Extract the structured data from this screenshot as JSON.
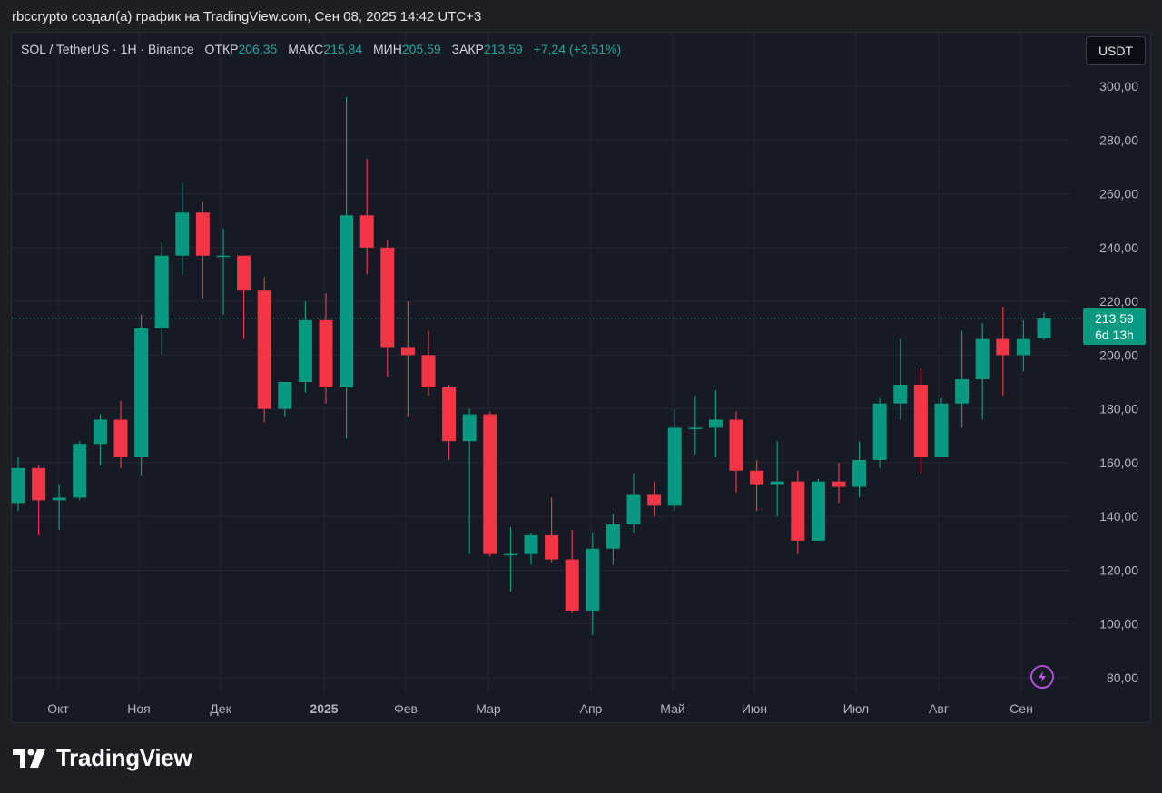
{
  "caption": "rbccrypto создал(а) график на TradingView.com, Сен 08, 2025 14:42 UTC+3",
  "legend": {
    "symbol": "SOL / TetherUS · 1H · Binance",
    "open_label": "ОТКР",
    "open_value": "206,35",
    "high_label": "МАКС",
    "high_value": "215,84",
    "low_label": "МИН",
    "low_value": "205,59",
    "close_label": "ЗАКР",
    "close_value": "213,59",
    "change": "+7,24 (+3,51%)"
  },
  "unit_button": "USDT",
  "last_price": {
    "value": "213,59",
    "countdown": "6d 13h"
  },
  "brand": "TradingView",
  "colors": {
    "up": "#089981",
    "down": "#f23645",
    "background": "#161a25",
    "grid": "#222631",
    "price_line": "#089981"
  },
  "icons": {
    "alert": "lightning-icon",
    "logo": "tradingview-logo-icon"
  },
  "chart_data": {
    "type": "candlestick",
    "x_ticks": [
      "Окт",
      "Ноя",
      "Дек",
      "2025",
      "Фев",
      "Мар",
      "Апр",
      "Май",
      "Июн",
      "Июл",
      "Авг",
      "Сен"
    ],
    "y_ticks": [
      "80,00",
      "100,00",
      "120,00",
      "140,00",
      "160,00",
      "180,00",
      "200,00",
      "220,00",
      "240,00",
      "260,00",
      "280,00",
      "300,00"
    ],
    "ylim": [
      75,
      308
    ],
    "grid": true,
    "last_close": 213.59,
    "candles": [
      {
        "o": 145,
        "h": 162,
        "l": 142,
        "c": 158
      },
      {
        "o": 158,
        "h": 159,
        "l": 133,
        "c": 146
      },
      {
        "o": 146,
        "h": 152,
        "l": 135,
        "c": 147
      },
      {
        "o": 147,
        "h": 168,
        "l": 146,
        "c": 167
      },
      {
        "o": 167,
        "h": 178,
        "l": 159,
        "c": 176
      },
      {
        "o": 176,
        "h": 183,
        "l": 158,
        "c": 162
      },
      {
        "o": 162,
        "h": 215,
        "l": 155,
        "c": 210
      },
      {
        "o": 210,
        "h": 242,
        "l": 200,
        "c": 237
      },
      {
        "o": 237,
        "h": 264,
        "l": 230,
        "c": 253
      },
      {
        "o": 253,
        "h": 257,
        "l": 221,
        "c": 237
      },
      {
        "o": 237,
        "h": 247,
        "l": 215,
        "c": 237
      },
      {
        "o": 237,
        "h": 237,
        "l": 206,
        "c": 224
      },
      {
        "o": 224,
        "h": 229,
        "l": 175,
        "c": 180
      },
      {
        "o": 180,
        "h": 190,
        "l": 177,
        "c": 190
      },
      {
        "o": 190,
        "h": 220,
        "l": 186,
        "c": 213
      },
      {
        "o": 213,
        "h": 223,
        "l": 182,
        "c": 188
      },
      {
        "o": 188,
        "h": 296,
        "l": 169,
        "c": 252
      },
      {
        "o": 252,
        "h": 273,
        "l": 230,
        "c": 240
      },
      {
        "o": 240,
        "h": 243,
        "l": 192,
        "c": 203
      },
      {
        "o": 203,
        "h": 220,
        "l": 177,
        "c": 200
      },
      {
        "o": 200,
        "h": 209,
        "l": 185,
        "c": 188
      },
      {
        "o": 188,
        "h": 189,
        "l": 161,
        "c": 168
      },
      {
        "o": 168,
        "h": 180,
        "l": 126,
        "c": 178
      },
      {
        "o": 178,
        "h": 179,
        "l": 125,
        "c": 126
      },
      {
        "o": 126,
        "h": 136,
        "l": 112,
        "c": 126
      },
      {
        "o": 126,
        "h": 134,
        "l": 122,
        "c": 133
      },
      {
        "o": 133,
        "h": 147,
        "l": 123,
        "c": 124
      },
      {
        "o": 124,
        "h": 135,
        "l": 104,
        "c": 105
      },
      {
        "o": 105,
        "h": 134,
        "l": 96,
        "c": 128
      },
      {
        "o": 128,
        "h": 141,
        "l": 122,
        "c": 137
      },
      {
        "o": 137,
        "h": 156,
        "l": 134,
        "c": 148
      },
      {
        "o": 148,
        "h": 153,
        "l": 140,
        "c": 144
      },
      {
        "o": 144,
        "h": 180,
        "l": 142,
        "c": 173
      },
      {
        "o": 173,
        "h": 185,
        "l": 163,
        "c": 173
      },
      {
        "o": 173,
        "h": 187,
        "l": 162,
        "c": 176
      },
      {
        "o": 176,
        "h": 179,
        "l": 149,
        "c": 157
      },
      {
        "o": 157,
        "h": 161,
        "l": 142,
        "c": 152
      },
      {
        "o": 152,
        "h": 168,
        "l": 140,
        "c": 153
      },
      {
        "o": 153,
        "h": 157,
        "l": 126,
        "c": 131
      },
      {
        "o": 131,
        "h": 154,
        "l": 131,
        "c": 153
      },
      {
        "o": 153,
        "h": 160,
        "l": 145,
        "c": 151
      },
      {
        "o": 151,
        "h": 168,
        "l": 147,
        "c": 161
      },
      {
        "o": 161,
        "h": 184,
        "l": 158,
        "c": 182
      },
      {
        "o": 182,
        "h": 206,
        "l": 176,
        "c": 189
      },
      {
        "o": 189,
        "h": 195,
        "l": 156,
        "c": 162
      },
      {
        "o": 162,
        "h": 184,
        "l": 162,
        "c": 182
      },
      {
        "o": 182,
        "h": 209,
        "l": 173,
        "c": 191
      },
      {
        "o": 191,
        "h": 212,
        "l": 176,
        "c": 206
      },
      {
        "o": 206,
        "h": 218,
        "l": 185,
        "c": 200
      },
      {
        "o": 200,
        "h": 213,
        "l": 194,
        "c": 206
      },
      {
        "o": 206.35,
        "h": 215.84,
        "l": 205.59,
        "c": 213.59
      }
    ]
  }
}
